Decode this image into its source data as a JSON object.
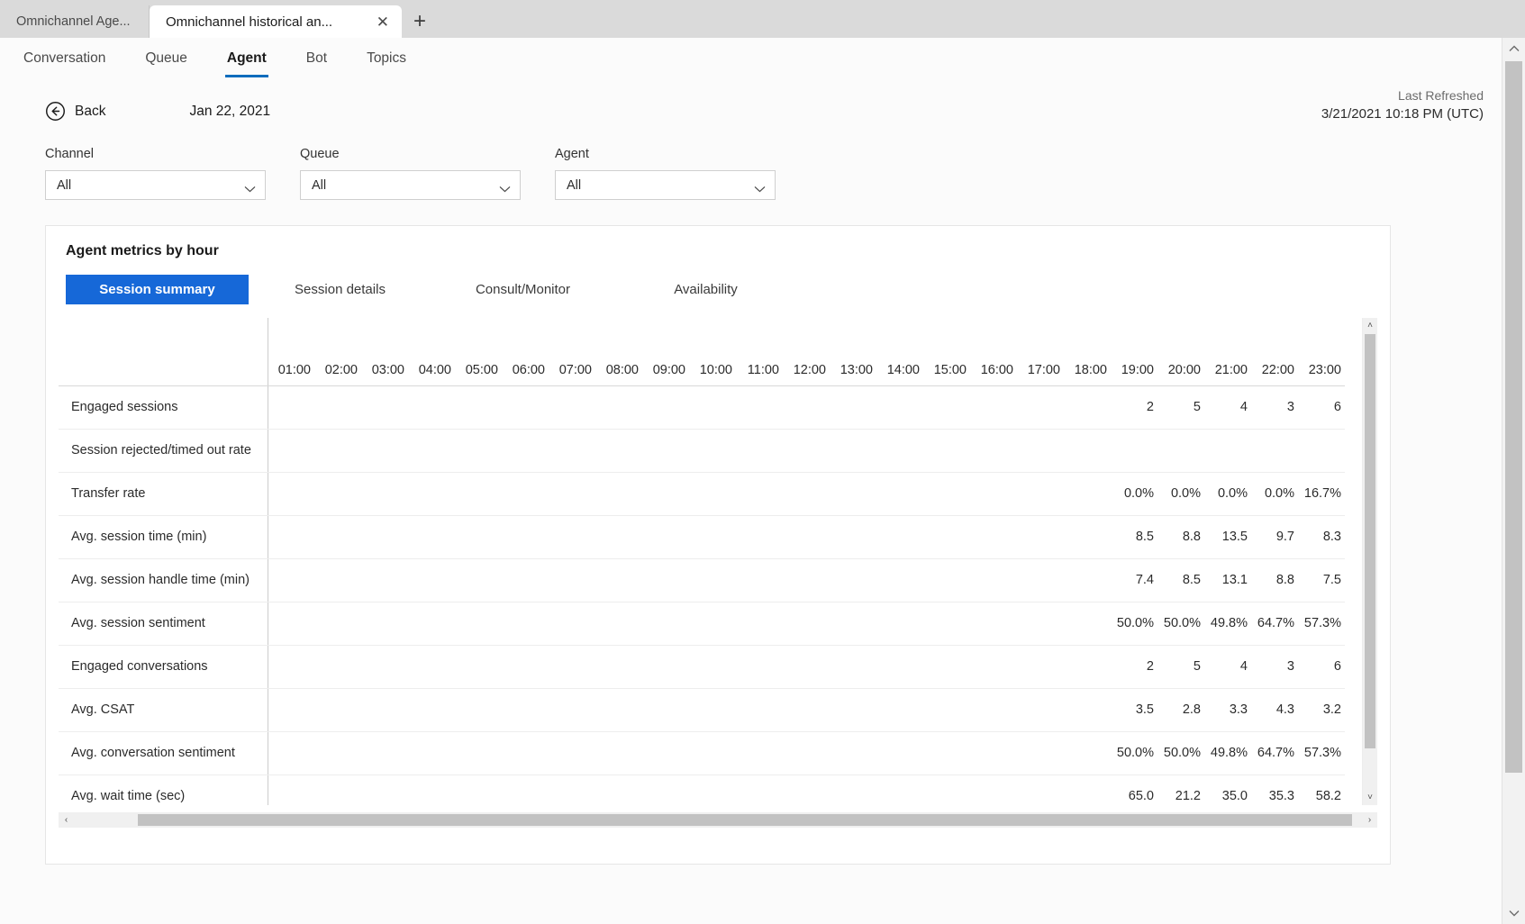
{
  "browser": {
    "tabs": [
      {
        "title": "Omnichannel Age...",
        "active": false
      },
      {
        "title": "Omnichannel historical an...",
        "active": true
      }
    ],
    "close_glyph": "✕",
    "newtab_glyph": "+"
  },
  "nav": {
    "items": [
      {
        "label": "Conversation",
        "active": false
      },
      {
        "label": "Queue",
        "active": false
      },
      {
        "label": "Agent",
        "active": true
      },
      {
        "label": "Bot",
        "active": false
      },
      {
        "label": "Topics",
        "active": false
      }
    ],
    "accent_color": "#0f6cbd"
  },
  "refresh": {
    "label": "Last Refreshed",
    "value": "3/21/2021 10:18 PM (UTC)"
  },
  "toolbar": {
    "back_label": "Back",
    "report_date": "Jan 22, 2021"
  },
  "filters": [
    {
      "label": "Channel",
      "value": "All"
    },
    {
      "label": "Queue",
      "value": "All"
    },
    {
      "label": "Agent",
      "value": "All"
    }
  ],
  "card": {
    "title": "Agent metrics by hour",
    "pivots": [
      {
        "label": "Session summary",
        "active": true
      },
      {
        "label": "Session details",
        "active": false
      },
      {
        "label": "Consult/Monitor",
        "active": false
      },
      {
        "label": "Availability",
        "active": false
      }
    ],
    "active_pivot_color": "#1668d8"
  },
  "chart_data": {
    "type": "table",
    "title": "Agent metrics by hour",
    "categories": [
      "01:00",
      "02:00",
      "03:00",
      "04:00",
      "05:00",
      "06:00",
      "07:00",
      "08:00",
      "09:00",
      "10:00",
      "11:00",
      "12:00",
      "13:00",
      "14:00",
      "15:00",
      "16:00",
      "17:00",
      "18:00",
      "19:00",
      "20:00",
      "21:00",
      "22:00",
      "23:00"
    ],
    "row_header_label": "",
    "series": [
      {
        "name": "Engaged sessions",
        "values": [
          "",
          "",
          "",
          "",
          "",
          "",
          "",
          "",
          "",
          "",
          "",
          "",
          "",
          "",
          "",
          "",
          "",
          "",
          "2",
          "5",
          "4",
          "3",
          "6"
        ]
      },
      {
        "name": "Session rejected/timed out rate",
        "values": [
          "",
          "",
          "",
          "",
          "",
          "",
          "",
          "",
          "",
          "",
          "",
          "",
          "",
          "",
          "",
          "",
          "",
          "",
          "",
          "",
          "",
          "",
          ""
        ]
      },
      {
        "name": "Transfer rate",
        "values": [
          "",
          "",
          "",
          "",
          "",
          "",
          "",
          "",
          "",
          "",
          "",
          "",
          "",
          "",
          "",
          "",
          "",
          "",
          "0.0%",
          "0.0%",
          "0.0%",
          "0.0%",
          "16.7%"
        ]
      },
      {
        "name": "Avg. session time (min)",
        "values": [
          "",
          "",
          "",
          "",
          "",
          "",
          "",
          "",
          "",
          "",
          "",
          "",
          "",
          "",
          "",
          "",
          "",
          "",
          "8.5",
          "8.8",
          "13.5",
          "9.7",
          "8.3"
        ]
      },
      {
        "name": "Avg. session handle time (min)",
        "values": [
          "",
          "",
          "",
          "",
          "",
          "",
          "",
          "",
          "",
          "",
          "",
          "",
          "",
          "",
          "",
          "",
          "",
          "",
          "7.4",
          "8.5",
          "13.1",
          "8.8",
          "7.5"
        ]
      },
      {
        "name": "Avg. session sentiment",
        "values": [
          "",
          "",
          "",
          "",
          "",
          "",
          "",
          "",
          "",
          "",
          "",
          "",
          "",
          "",
          "",
          "",
          "",
          "",
          "50.0%",
          "50.0%",
          "49.8%",
          "64.7%",
          "57.3%"
        ]
      },
      {
        "name": "Engaged conversations",
        "values": [
          "",
          "",
          "",
          "",
          "",
          "",
          "",
          "",
          "",
          "",
          "",
          "",
          "",
          "",
          "",
          "",
          "",
          "",
          "2",
          "5",
          "4",
          "3",
          "6"
        ]
      },
      {
        "name": "Avg. CSAT",
        "values": [
          "",
          "",
          "",
          "",
          "",
          "",
          "",
          "",
          "",
          "",
          "",
          "",
          "",
          "",
          "",
          "",
          "",
          "",
          "3.5",
          "2.8",
          "3.3",
          "4.3",
          "3.2"
        ]
      },
      {
        "name": "Avg. conversation sentiment",
        "values": [
          "",
          "",
          "",
          "",
          "",
          "",
          "",
          "",
          "",
          "",
          "",
          "",
          "",
          "",
          "",
          "",
          "",
          "",
          "50.0%",
          "50.0%",
          "49.8%",
          "64.7%",
          "57.3%"
        ]
      },
      {
        "name": "Avg. wait time (sec)",
        "values": [
          "",
          "",
          "",
          "",
          "",
          "",
          "",
          "",
          "",
          "",
          "",
          "",
          "",
          "",
          "",
          "",
          "",
          "",
          "65.0",
          "21.2",
          "35.0",
          "35.3",
          "58.2"
        ]
      }
    ]
  },
  "scrollbars": {
    "up_glyph": "˄",
    "down_glyph": "˅",
    "left_glyph": "‹",
    "right_glyph": "›"
  }
}
